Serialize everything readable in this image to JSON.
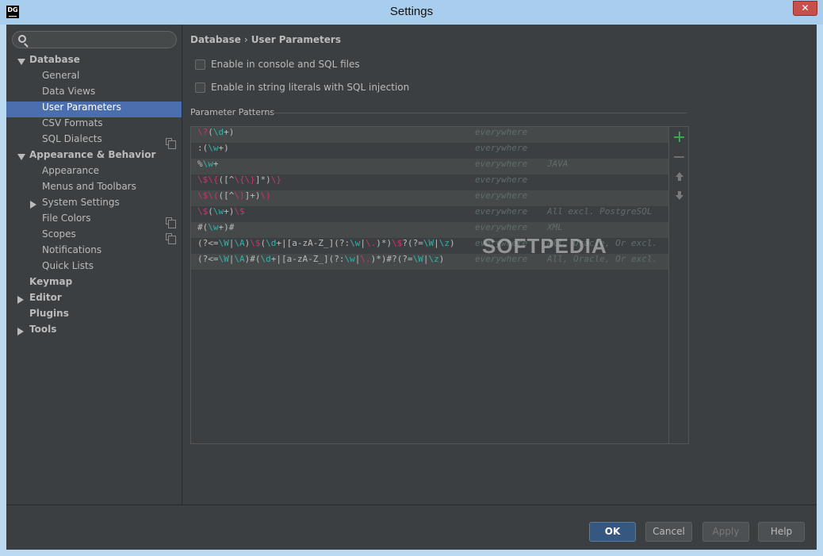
{
  "window": {
    "app_icon": "DG",
    "title": "Settings",
    "close_glyph": "✕"
  },
  "search": {
    "placeholder": "",
    "value": ""
  },
  "sidebar": {
    "items": [
      {
        "label": "Database",
        "level": 0,
        "expander": "expanded",
        "bold": true
      },
      {
        "label": "General",
        "level": 1
      },
      {
        "label": "Data Views",
        "level": 1
      },
      {
        "label": "User Parameters",
        "level": 1,
        "selected": true
      },
      {
        "label": "CSV Formats",
        "level": 1
      },
      {
        "label": "SQL Dialects",
        "level": 1,
        "icon": "copy-icon"
      },
      {
        "label": "Appearance & Behavior",
        "level": 0,
        "expander": "expanded",
        "bold": true
      },
      {
        "label": "Appearance",
        "level": 1
      },
      {
        "label": "Menus and Toolbars",
        "level": 1
      },
      {
        "label": "System Settings",
        "level": 1,
        "expander": "collapsed"
      },
      {
        "label": "File Colors",
        "level": 1,
        "icon": "copy-icon"
      },
      {
        "label": "Scopes",
        "level": 1,
        "icon": "copy-icon"
      },
      {
        "label": "Notifications",
        "level": 1
      },
      {
        "label": "Quick Lists",
        "level": 1
      },
      {
        "label": "Keymap",
        "level": 0,
        "bold": true
      },
      {
        "label": "Editor",
        "level": 0,
        "expander": "collapsed",
        "bold": true
      },
      {
        "label": "Plugins",
        "level": 0,
        "bold": true
      },
      {
        "label": "Tools",
        "level": 0,
        "expander": "collapsed",
        "bold": true
      }
    ]
  },
  "breadcrumb": {
    "parent": "Database",
    "separator": "›",
    "current": "User Parameters"
  },
  "options": {
    "console_sql": {
      "label": "Enable in console and SQL files",
      "checked": false
    },
    "string_literals": {
      "label": "Enable in string literals with SQL injection",
      "checked": false
    }
  },
  "patterns": {
    "title": "Parameter Patterns",
    "rows": [
      {
        "pattern": "\\?(\\d+)",
        "scope": "everywhere",
        "dialect": ""
      },
      {
        "pattern": ":(\\w+)",
        "scope": "everywhere",
        "dialect": ""
      },
      {
        "pattern": "%\\w+",
        "scope": "everywhere",
        "dialect": "JAVA"
      },
      {
        "pattern": "\\$\\{([^\\{\\}]*)\\}",
        "scope": "everywhere",
        "dialect": ""
      },
      {
        "pattern": "\\$\\(([^\\)]+)\\)",
        "scope": "everywhere",
        "dialect": ""
      },
      {
        "pattern": "\\$(\\w+)\\$",
        "scope": "everywhere",
        "dialect": "All excl. PostgreSQL"
      },
      {
        "pattern": "#(\\w+)#",
        "scope": "everywhere",
        "dialect": "XML"
      },
      {
        "pattern": "(?<=\\W|\\A)\\$(\\d+|[a-zA-Z_](?:\\w|\\.)*)\\$?(?=\\W|\\z)",
        "scope": "everywhere",
        "dialect": "All, Oracle, Or excl."
      },
      {
        "pattern": "(?<=\\W|\\A)#(\\d+|[a-zA-Z_](?:\\w|\\.)*)#?(?=\\W|\\z)",
        "scope": "everywhere",
        "dialect": "All, Oracle, Or excl."
      }
    ],
    "toolbar": [
      "plus-icon",
      "minus-icon",
      "arrow-up-icon",
      "arrow-down-icon"
    ]
  },
  "watermark": "SOFTPEDIA",
  "buttons": {
    "ok": "OK",
    "cancel": "Cancel",
    "apply": "Apply",
    "help": "Help"
  }
}
